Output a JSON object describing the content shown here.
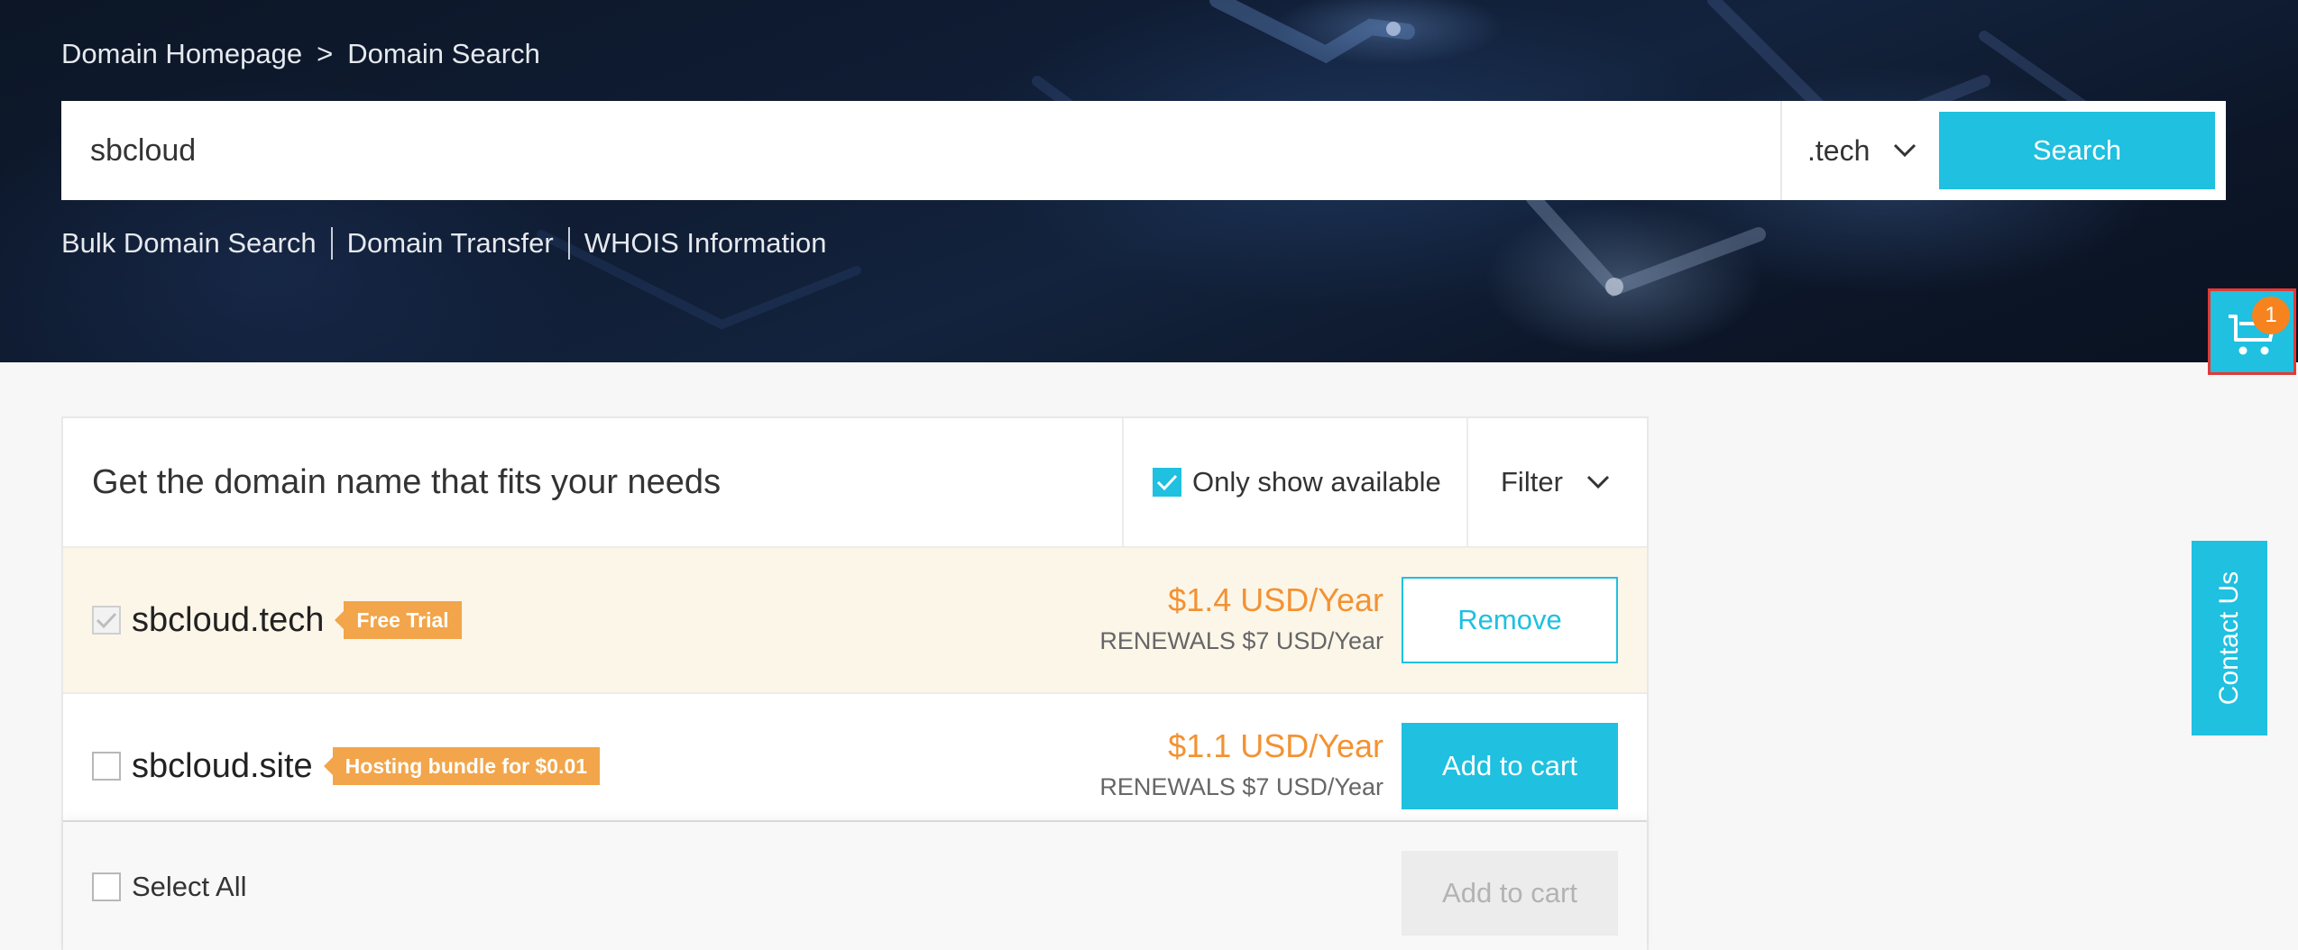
{
  "breadcrumb": {
    "home": "Domain Homepage",
    "separator": ">",
    "current": "Domain Search"
  },
  "search": {
    "value": "sbcloud",
    "tld": ".tech",
    "button_label": "Search"
  },
  "quick_links": [
    "Bulk Domain Search",
    "Domain Transfer",
    "WHOIS Information"
  ],
  "cart": {
    "count": "1",
    "icon": "cart-icon"
  },
  "contact": {
    "label": "Contact Us"
  },
  "results": {
    "title": "Get the domain name that fits your needs",
    "only_available_label": "Only show available",
    "only_available_checked": true,
    "filter_label": "Filter",
    "rows": [
      {
        "domain": "sbcloud.tech",
        "tag": "Free Trial",
        "price": "$1.4 USD/Year",
        "renewal": "RENEWALS $7 USD/Year",
        "action": "Remove",
        "selected": true
      },
      {
        "domain": "sbcloud.site",
        "tag": "Hosting bundle for $0.01",
        "price": "$1.1 USD/Year",
        "renewal": "RENEWALS $7 USD/Year",
        "action": "Add to cart",
        "selected": false
      }
    ],
    "footer": {
      "select_all_label": "Select All",
      "add_to_cart_label": "Add to cart"
    }
  },
  "colors": {
    "accent": "#1fc0e0",
    "price": "#f39233",
    "tag": "#f2a54a",
    "badge": "#f7831f",
    "highlight": "#e53935"
  }
}
